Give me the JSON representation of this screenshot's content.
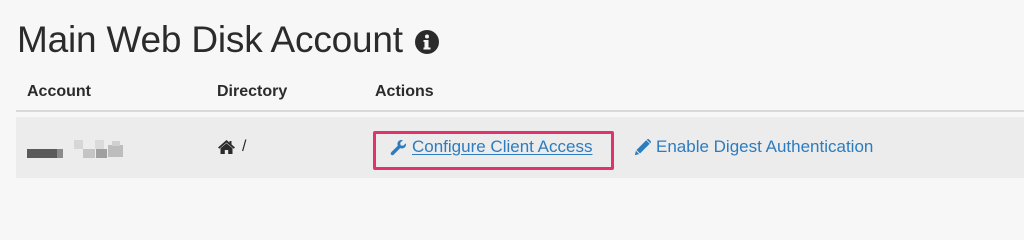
{
  "page": {
    "title": "Main Web Disk Account",
    "info_icon": "info-circle-icon"
  },
  "table": {
    "headers": {
      "account": "Account",
      "directory": "Directory",
      "actions": "Actions"
    },
    "rows": [
      {
        "account_redacted": true,
        "directory": "/",
        "directory_icon": "home-icon",
        "actions": [
          {
            "label": "Configure Client Access",
            "icon": "wrench-icon",
            "highlighted": true
          },
          {
            "label": "Enable Digest Authentication",
            "icon": "pencil-icon",
            "highlighted": false
          }
        ]
      }
    ]
  },
  "colors": {
    "background": "#f7f7f7",
    "row_background": "#ececec",
    "text": "#2b2b2b",
    "link": "#2c7cbf",
    "highlight": "#e0336b"
  }
}
